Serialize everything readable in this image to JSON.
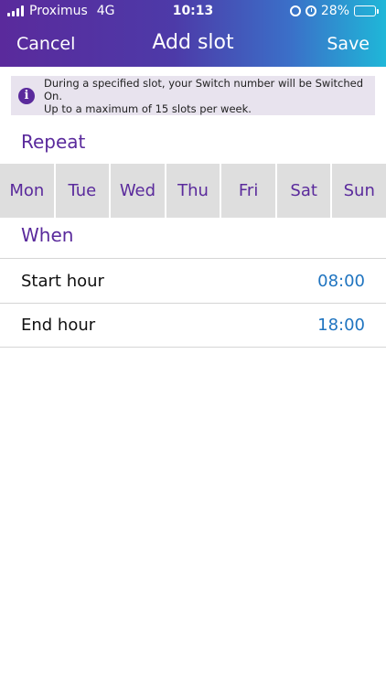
{
  "status_bar": {
    "carrier": "Proximus",
    "network": "4G",
    "time": "10:13",
    "battery": "28%",
    "battery_level": 0.28,
    "battery_color": "#f4d21f"
  },
  "nav": {
    "cancel": "Cancel",
    "title": "Add slot",
    "save": "Save"
  },
  "info": {
    "icon": "info-icon",
    "line1": "During a specified slot, your Switch number will be Switched On.",
    "line2": "Up to a maximum of 15 slots per week."
  },
  "repeat": {
    "title": "Repeat",
    "days": [
      "Mon",
      "Tue",
      "Wed",
      "Thu",
      "Fri",
      "Sat",
      "Sun"
    ]
  },
  "when": {
    "title": "When",
    "start_label": "Start hour",
    "start_value": "08:00",
    "end_label": "End hour",
    "end_value": "18:00"
  },
  "colors": {
    "accent": "#5a2a9c",
    "value": "#1f74c0",
    "day_bg": "#dedede"
  }
}
